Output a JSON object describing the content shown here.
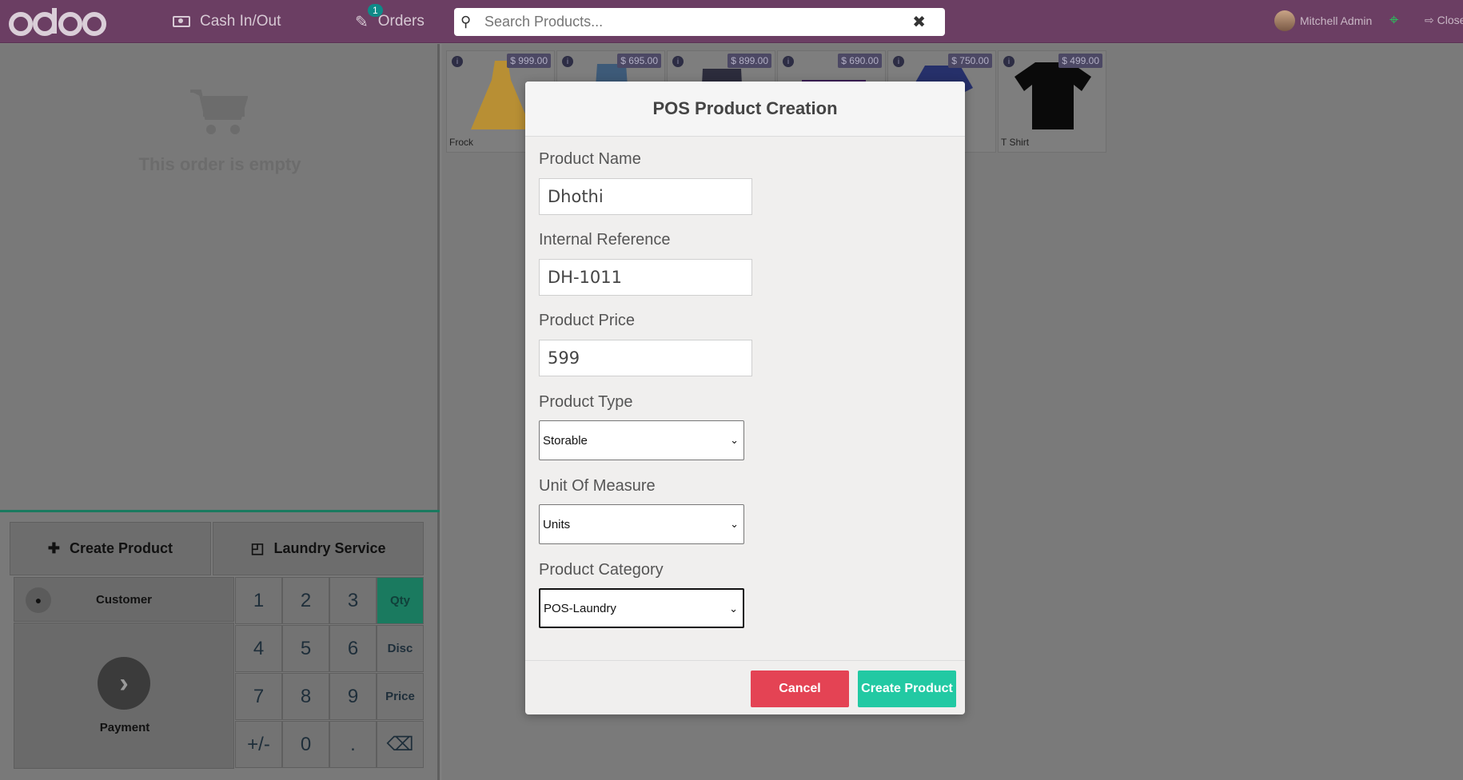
{
  "topbar": {
    "logo_text": "odoo",
    "cash_label": "Cash In/Out",
    "orders_label": "Orders",
    "orders_count": "1",
    "search_placeholder": "Search Products...",
    "user_name": "Mitchell Admin",
    "close_label": "Close"
  },
  "order": {
    "empty_message": "This order is empty"
  },
  "controls": {
    "create_product_label": "Create Product",
    "laundry_service_label": "Laundry Service"
  },
  "numpad": {
    "customer_label": "Customer",
    "payment_label": "Payment",
    "keys": [
      "1",
      "2",
      "3",
      "4",
      "5",
      "6",
      "7",
      "8",
      "9",
      "+/-",
      "0",
      "."
    ],
    "modes": [
      "Qty",
      "Disc",
      "Price"
    ],
    "active_mode": "Qty"
  },
  "products": [
    {
      "name": "Frock",
      "price": "$ 999.00"
    },
    {
      "name": "",
      "price": "$ 695.00"
    },
    {
      "name": "",
      "price": "$ 899.00"
    },
    {
      "name": "",
      "price": "$ 690.00"
    },
    {
      "name": "",
      "price": "$ 750.00"
    },
    {
      "name": "T Shirt",
      "price": "$ 499.00"
    }
  ],
  "modal": {
    "title": "POS Product Creation",
    "product_name_label": "Product Name",
    "product_name_value": "Dhothi",
    "internal_ref_label": "Internal Reference",
    "internal_ref_value": "DH-1011",
    "price_label": "Product Price",
    "price_value": "599",
    "type_label": "Product Type",
    "type_value": "Storable",
    "uom_label": "Unit Of Measure",
    "uom_value": "Units",
    "category_label": "Product Category",
    "category_value": "POS-Laundry",
    "cancel_label": "Cancel",
    "create_label": "Create Product"
  },
  "colors": {
    "topbar": "#6b3e63",
    "accent": "#22c9a3",
    "danger": "#e44354",
    "active_mode": "#1a7a5f"
  }
}
